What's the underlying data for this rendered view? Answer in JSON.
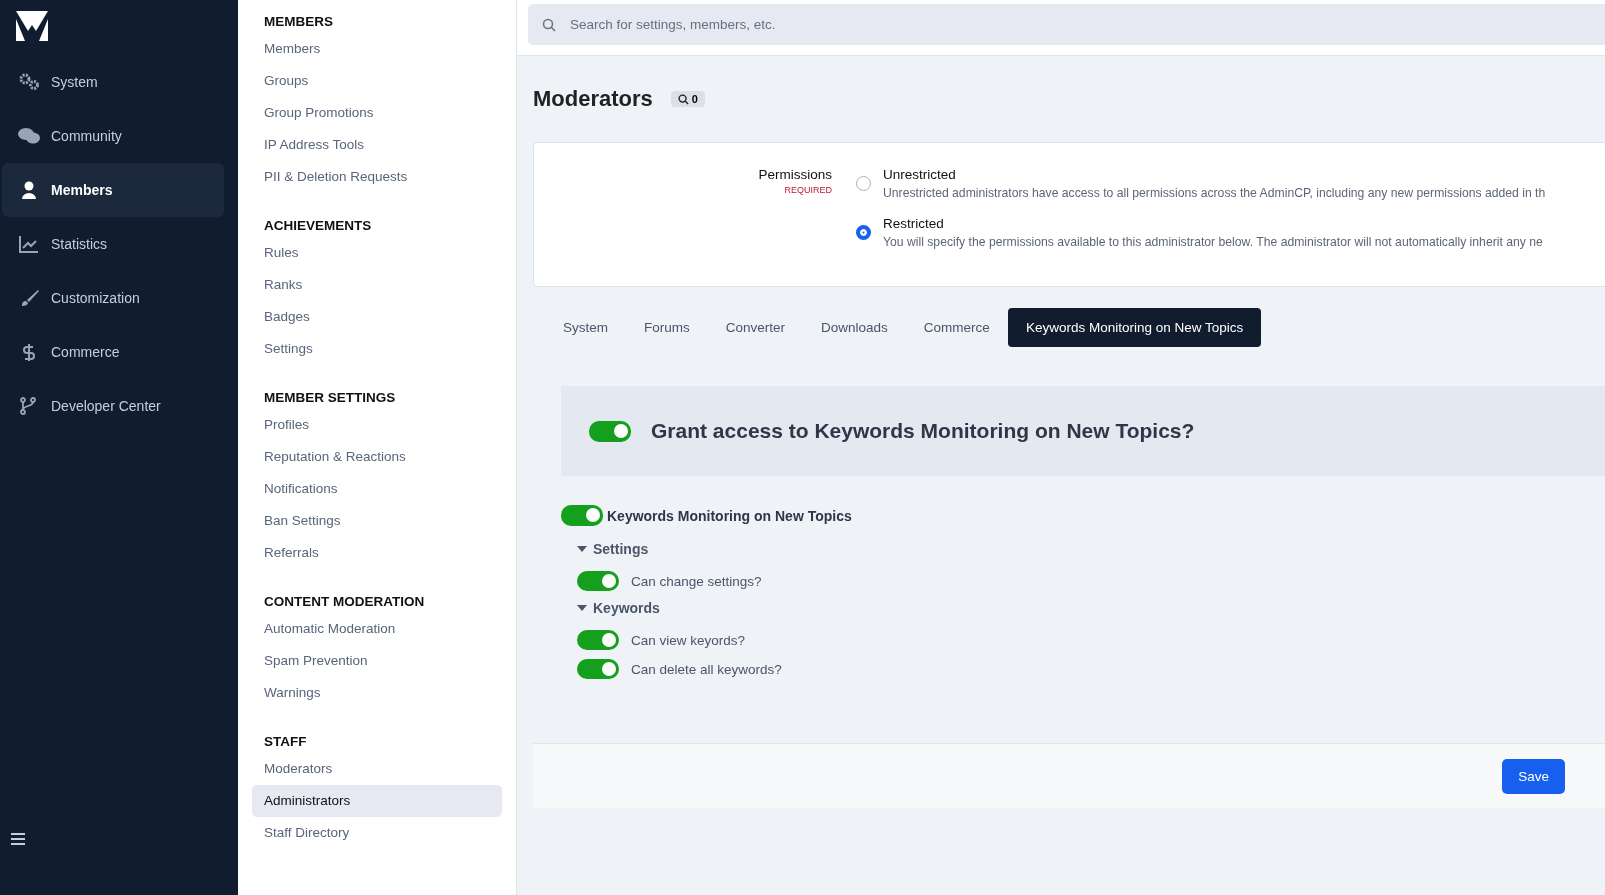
{
  "nav": {
    "items": [
      {
        "label": "System",
        "selected": false
      },
      {
        "label": "Community",
        "selected": false
      },
      {
        "label": "Members",
        "selected": true
      },
      {
        "label": "Statistics",
        "selected": false
      },
      {
        "label": "Customization",
        "selected": false
      },
      {
        "label": "Commerce",
        "selected": false
      },
      {
        "label": "Developer Center",
        "selected": false
      }
    ]
  },
  "subnav": {
    "sections": [
      {
        "title": "MEMBERS",
        "items": [
          {
            "label": "Members",
            "selected": false
          },
          {
            "label": "Groups",
            "selected": false
          },
          {
            "label": "Group Promotions",
            "selected": false
          },
          {
            "label": "IP Address Tools",
            "selected": false
          },
          {
            "label": "PII & Deletion Requests",
            "selected": false
          }
        ]
      },
      {
        "title": "ACHIEVEMENTS",
        "items": [
          {
            "label": "Rules",
            "selected": false
          },
          {
            "label": "Ranks",
            "selected": false
          },
          {
            "label": "Badges",
            "selected": false
          },
          {
            "label": "Settings",
            "selected": false
          }
        ]
      },
      {
        "title": "MEMBER SETTINGS",
        "items": [
          {
            "label": "Profiles",
            "selected": false
          },
          {
            "label": "Reputation & Reactions",
            "selected": false
          },
          {
            "label": "Notifications",
            "selected": false
          },
          {
            "label": "Ban Settings",
            "selected": false
          },
          {
            "label": "Referrals",
            "selected": false
          }
        ]
      },
      {
        "title": "CONTENT MODERATION",
        "items": [
          {
            "label": "Automatic Moderation",
            "selected": false
          },
          {
            "label": "Spam Prevention",
            "selected": false
          },
          {
            "label": "Warnings",
            "selected": false
          }
        ]
      },
      {
        "title": "STAFF",
        "items": [
          {
            "label": "Moderators",
            "selected": false
          },
          {
            "label": "Administrators",
            "selected": true
          },
          {
            "label": "Staff Directory",
            "selected": false
          }
        ]
      }
    ]
  },
  "search": {
    "placeholder": "Search for settings, members, etc."
  },
  "page": {
    "title": "Moderators",
    "badge": "0"
  },
  "permissions": {
    "label": "Permissions",
    "required": "REQUIRED",
    "options": [
      {
        "label": "Unrestricted",
        "description": "Unrestricted administrators have access to all permissions across the AdminCP, including any new permissions added in th",
        "selected": false
      },
      {
        "label": "Restricted",
        "description": "You will specify the permissions available to this administrator below. The administrator will not automatically inherit any ne",
        "selected": true
      }
    ]
  },
  "tabs": [
    {
      "label": "System",
      "selected": false
    },
    {
      "label": "Forums",
      "selected": false
    },
    {
      "label": "Converter",
      "selected": false
    },
    {
      "label": "Downloads",
      "selected": false
    },
    {
      "label": "Commerce",
      "selected": false
    },
    {
      "label": "Keywords Monitoring on New Topics",
      "selected": true
    }
  ],
  "grant": {
    "label": "Grant access to Keywords Monitoring on New Topics?",
    "on": true
  },
  "tree": {
    "label": "Keywords Monitoring on New Topics",
    "on": true,
    "children": [
      {
        "label": "Settings",
        "expanded": true,
        "children": [
          {
            "label": "Can change settings?",
            "on": true
          }
        ]
      },
      {
        "label": "Keywords",
        "expanded": true,
        "children": [
          {
            "label": "Can view keyords?",
            "on": true
          },
          {
            "label": "Can delete all keywords?",
            "on": true
          }
        ]
      }
    ]
  },
  "save_button": "Save"
}
